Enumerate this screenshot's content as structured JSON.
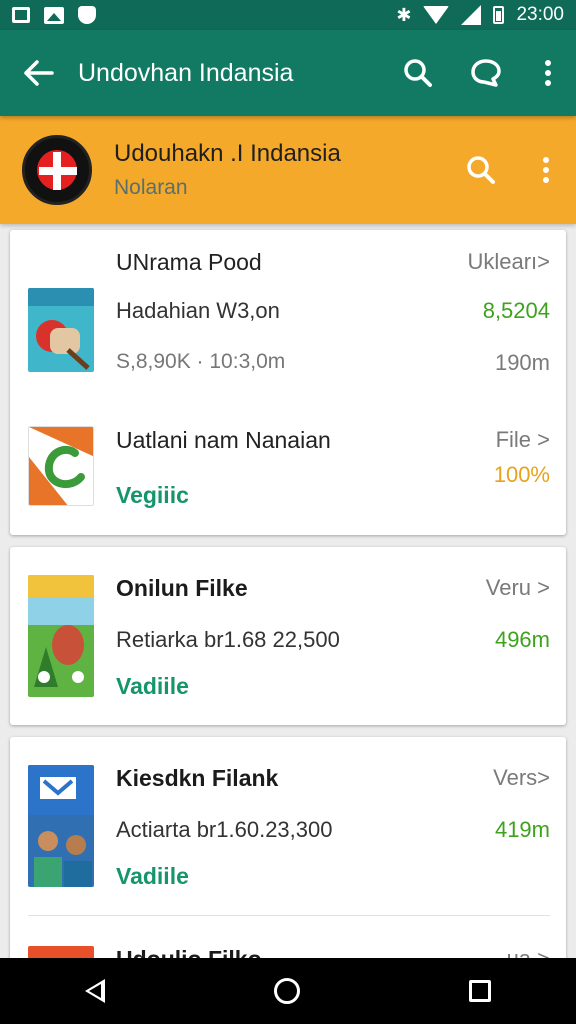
{
  "status_bar": {
    "time": "23:00"
  },
  "app_bar": {
    "title": "Undovhan Indansia"
  },
  "sub_header": {
    "title": "Udouhakn .I Indansia",
    "subtitle": "Nolaran"
  },
  "items": [
    {
      "title": "UNrama Pood",
      "right_top": "Uklearı>",
      "sub": "Hadahian W3,on",
      "right_mid": "8,5204",
      "meta": "S,8,90K · 10:3,0m",
      "right_bot": "190m"
    },
    {
      "title": "Uatlani nam Nanaian",
      "right_top": "File >",
      "right_mid": "100%",
      "status": "Vegiiic"
    },
    {
      "title": "Onilun Filke",
      "right_top": "Veru >",
      "sub": "Retiarka br1.68 22,500",
      "right_mid": "496m",
      "status": "Vadiile"
    },
    {
      "title": "Kiesdkn Filank",
      "right_top": "Vers>",
      "sub": "Actiarta br1.60.23,300",
      "right_mid": "419m",
      "status": "Vadiile"
    },
    {
      "title": "Udoulio Filko",
      "right_top": "ua >"
    }
  ],
  "colors": {
    "app_bar": "#127a62",
    "sub_header": "#f4a92a",
    "accent_green": "#16956d"
  }
}
